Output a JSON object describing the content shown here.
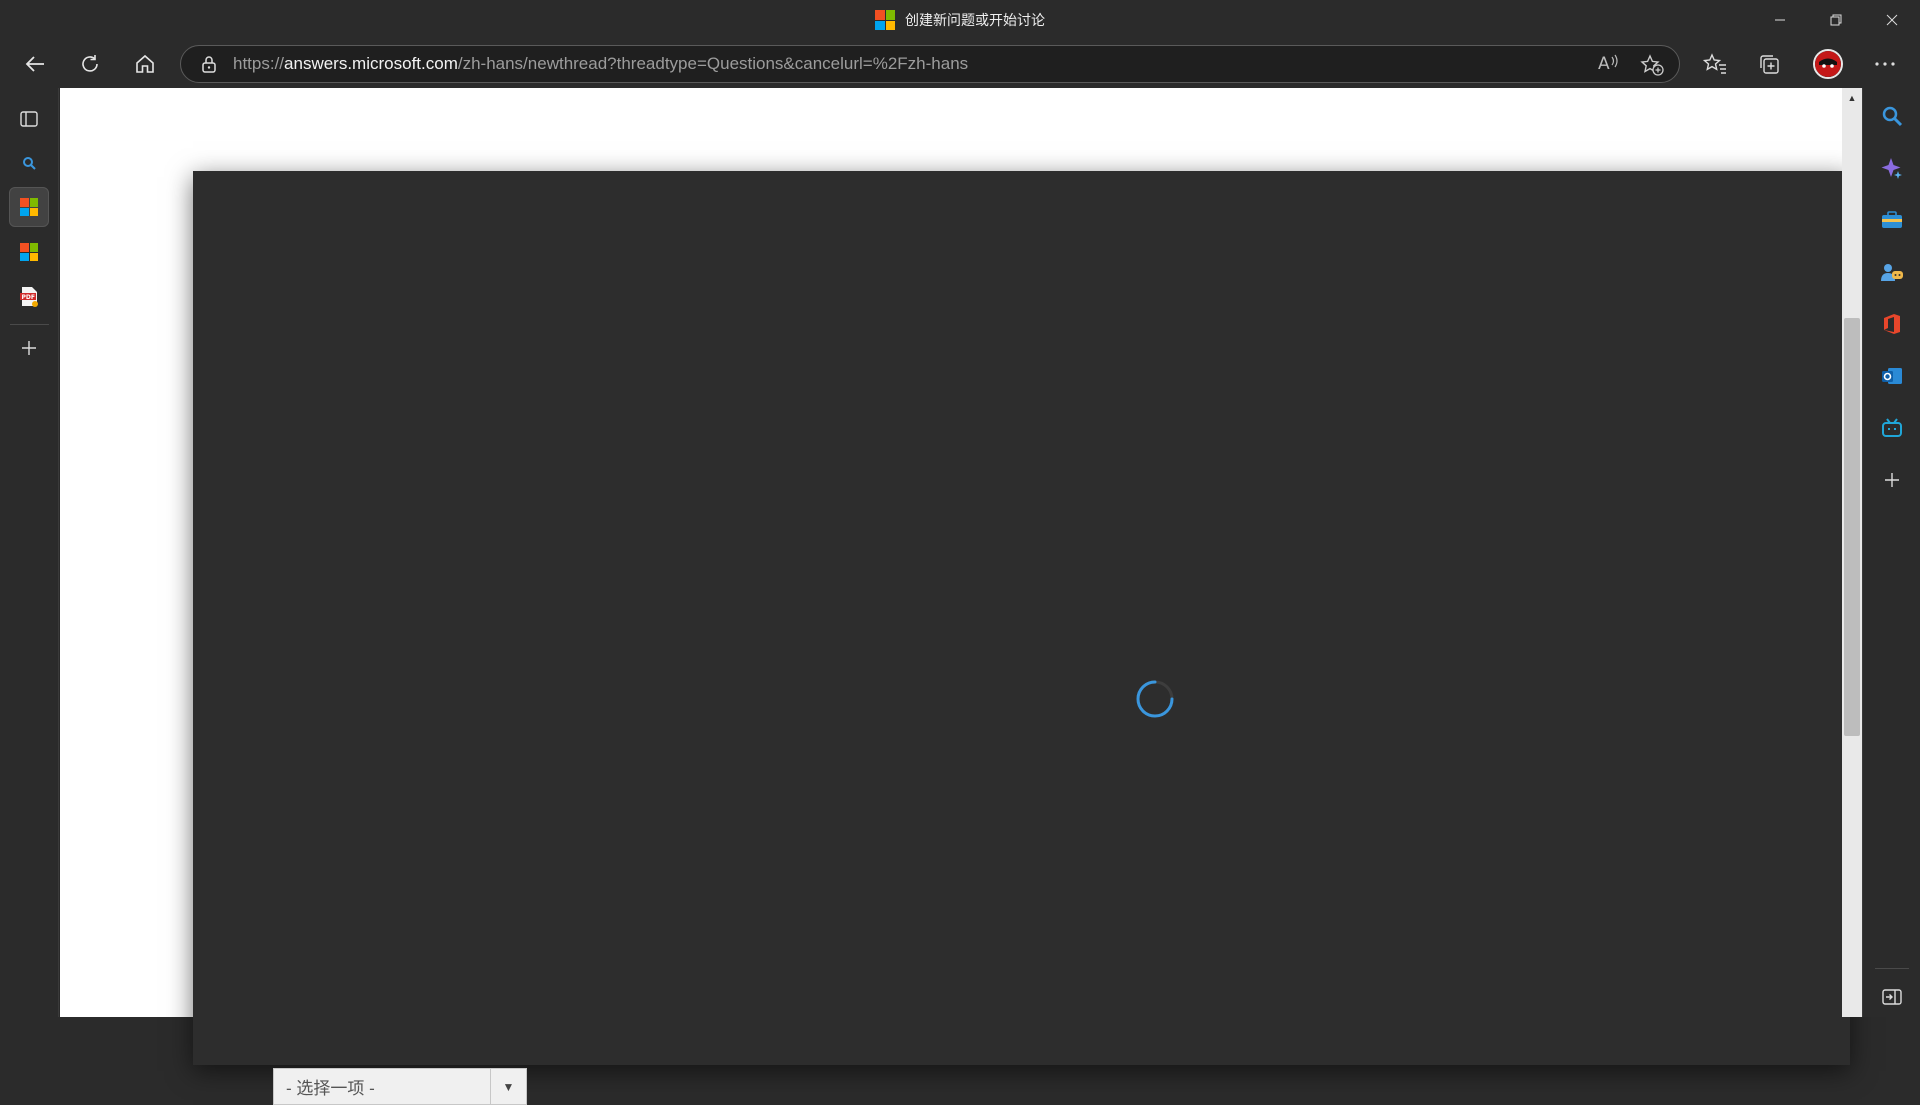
{
  "window": {
    "title": "创建新问题或开始讨论",
    "controls": [
      "minimize",
      "restore",
      "close"
    ]
  },
  "toolbar": {
    "url_scheme": "https://",
    "url_host": "answers.microsoft.com",
    "url_path": "/zh-hans/newthread?threadtype=Questions&cancelurl=%2Fzh-hans",
    "read_aloud_label": "Aͅ"
  },
  "vertical_tabs": [
    {
      "name": "tab-actions-icon"
    },
    {
      "name": "search-tab-icon"
    },
    {
      "name": "microsoft-tab-active",
      "active": true
    },
    {
      "name": "microsoft-tab"
    },
    {
      "name": "pdf-tab-icon"
    },
    {
      "name": "new-tab-plus-icon"
    }
  ],
  "page": {
    "select_placeholder": "- 选择一项 -",
    "loading": true
  },
  "right_sidebar": [
    "search-icon",
    "copilot-sparkle-icon",
    "tools-briefcase-icon",
    "games-icon",
    "office-icon",
    "outlook-icon",
    "bilibili-icon",
    "add-icon",
    "collapse-sidebar-icon"
  ],
  "colors": {
    "accent": "#3a96dd",
    "chrome_bg": "#2b2b2b",
    "modal_bg": "#2d2d2d"
  }
}
